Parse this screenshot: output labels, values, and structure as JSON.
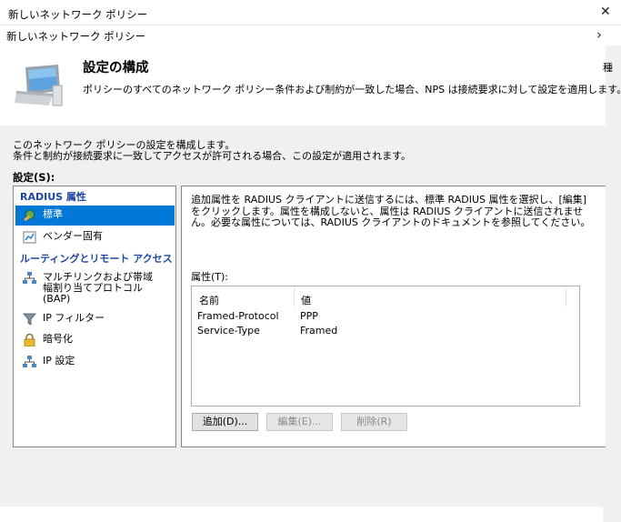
{
  "window": {
    "title": "新しいネットワーク ポリシー",
    "breadcrumb": "新しいネットワーク ポリシー"
  },
  "header": {
    "title": "設定の構成",
    "description": "ポリシーのすべてのネットワーク ポリシー条件および制約が一致した場合、NPS は接続要求に対して設定を適用します。",
    "cut_text": "種"
  },
  "intro": {
    "line1": "このネットワーク ポリシーの設定を構成します。",
    "line2": "条件と制約が接続要求に一致してアクセスが許可される場合、この設定が適用されます。"
  },
  "settings_label": "設定(S):",
  "nav": {
    "radius_heading": "RADIUS 属性",
    "radius_items": [
      {
        "label": "標準",
        "icon": "wrench-icon",
        "selected": true
      },
      {
        "label": "ベンダー固有",
        "icon": "vendor-icon",
        "selected": false
      }
    ],
    "routing_heading": "ルーティングとリモート アクセス",
    "routing_items": [
      {
        "label_lines": [
          "マルチリンクおよび帯域",
          "幅割り当てプロトコル",
          "(BAP)"
        ],
        "icon": "network-icon"
      },
      {
        "label": "IP フィルター",
        "icon": "filter-icon"
      },
      {
        "label": "暗号化",
        "icon": "lock-icon"
      },
      {
        "label": "IP 設定",
        "icon": "network-icon"
      }
    ]
  },
  "content": {
    "description": "追加属性を RADIUS クライアントに送信するには、標準 RADIUS 属性を選択し、[編集] をクリックします。属性を構成しないと、属性は RADIUS クライアントに送信されません。必要な属性については、RADIUS クライアントのドキュメントを参照してください。",
    "attributes_label": "属性(T):",
    "table": {
      "columns": [
        "名前",
        "値"
      ],
      "rows": [
        [
          "Framed-Protocol",
          "PPP"
        ],
        [
          "Service-Type",
          "Framed"
        ]
      ]
    },
    "buttons": {
      "add": "追加(D)...",
      "edit": "編集(E)...",
      "delete": "削除(R)"
    }
  }
}
